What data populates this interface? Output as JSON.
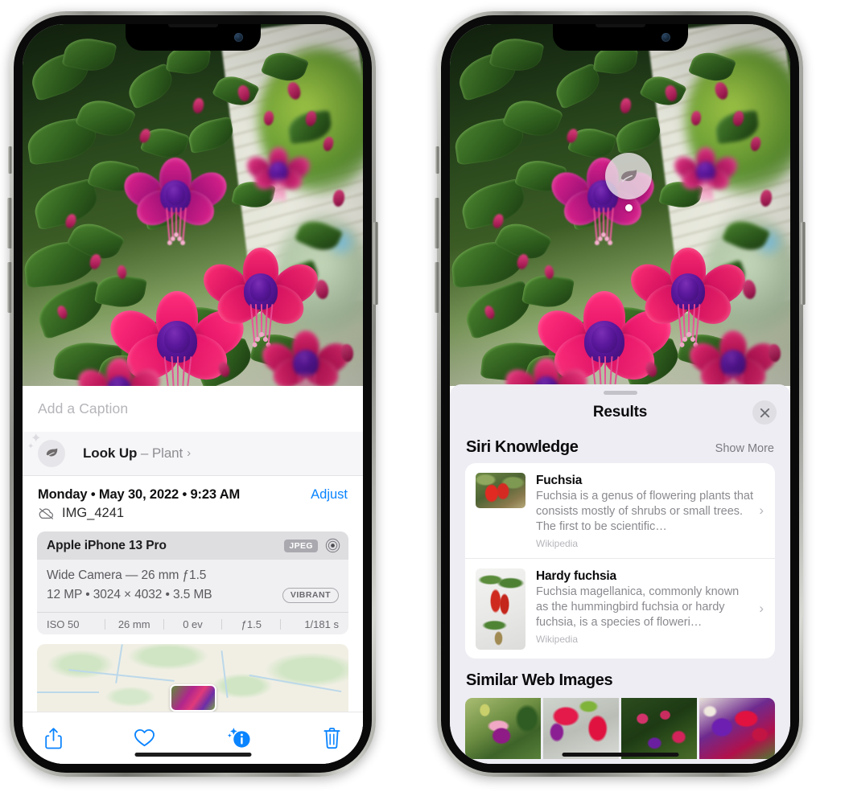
{
  "left_phone": {
    "caption": {
      "placeholder": "Add a Caption"
    },
    "look_up": {
      "label": "Look Up",
      "dash": "–",
      "subject": "Plant",
      "chevron": "›",
      "icon": "leaf-icon"
    },
    "info": {
      "datetime": "Monday • May 30, 2022 • 9:23 AM",
      "adjust_label": "Adjust",
      "filename": "IMG_4241",
      "cloud_icon": "icloud-slash-icon"
    },
    "exif": {
      "device": "Apple iPhone 13 Pro",
      "format_chip": "JPEG",
      "aperture_icon": "lens-icon",
      "lens_line": "Wide Camera — 26 mm ƒ1.5",
      "size_line": "12 MP • 3024 × 4032 • 3.5 MB",
      "style_chip": "VIBRANT",
      "stats": [
        "ISO 50",
        "26 mm",
        "0 ev",
        "ƒ1.5",
        "1/181 s"
      ]
    },
    "toolbar": [
      {
        "name": "share-icon",
        "label": "Share"
      },
      {
        "name": "heart-icon",
        "label": "Favorite"
      },
      {
        "name": "info-sparkle-icon",
        "label": "Info"
      },
      {
        "name": "trash-icon",
        "label": "Delete"
      }
    ]
  },
  "right_phone": {
    "badge": {
      "icon": "leaf-icon",
      "name": "visual-look-up-badge"
    },
    "sheet": {
      "title": "Results",
      "close_icon": "close-icon"
    },
    "siri_knowledge": {
      "heading": "Siri Knowledge",
      "show_more": "Show More",
      "items": [
        {
          "title": "Fuchsia",
          "description": "Fuchsia is a genus of flowering plants that consists mostly of shrubs or small trees. The first to be scientific…",
          "source": "Wikipedia",
          "chevron": "›"
        },
        {
          "title": "Hardy fuchsia",
          "description": "Fuchsia magellanica, commonly known as the hummingbird fuchsia or hardy fuchsia, is a species of floweri…",
          "source": "Wikipedia",
          "chevron": "›"
        }
      ]
    },
    "similar_web_images": {
      "heading": "Similar Web Images",
      "count": 4
    }
  },
  "colors": {
    "accent_blue": "#0a84ff",
    "sheet_bg": "#eeedf3",
    "card_bg": "#ffffff",
    "secondary_text": "#8a8a90",
    "look_up_row_bg": "#f6f6f8",
    "exif_head_bg": "#dedee1"
  }
}
